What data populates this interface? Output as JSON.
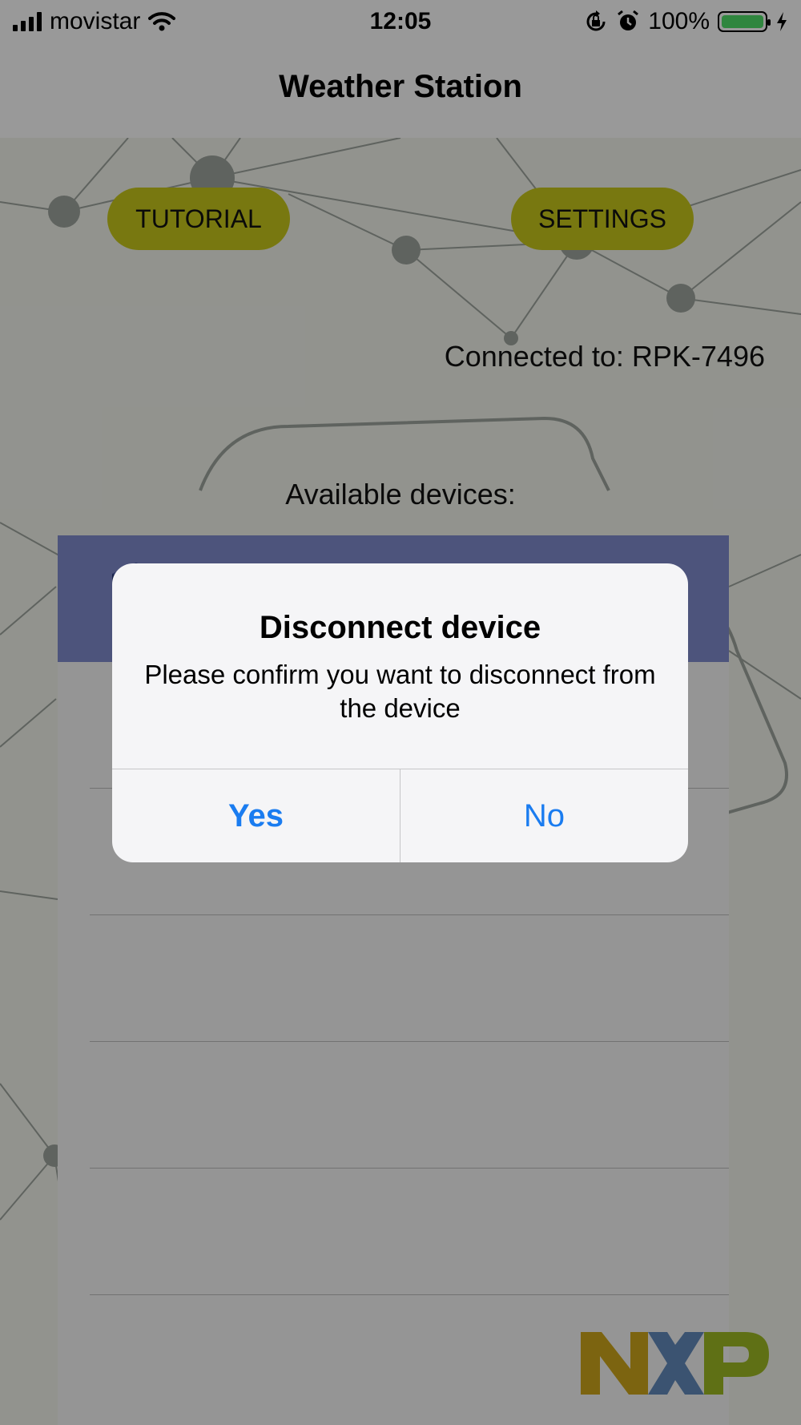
{
  "status_bar": {
    "carrier": "movistar",
    "time": "12:05",
    "battery_percent": "100%",
    "battery_level": 1.0,
    "icons": [
      "signal-icon",
      "wifi-icon",
      "orientation-lock-icon",
      "alarm-icon",
      "battery-icon",
      "charging-icon"
    ]
  },
  "nav": {
    "title": "Weather Station"
  },
  "main": {
    "tutorial_label": "TUTORIAL",
    "settings_label": "SETTINGS",
    "connected_text": "Connected to: RPK-7496",
    "available_label": "Available devices:",
    "logo_text": "NXP",
    "colors": {
      "pill": "#c2c21a",
      "selected_row": "#7c88c8",
      "link_blue": "#1a7cf0"
    }
  },
  "alert": {
    "title": "Disconnect device",
    "message": "Please confirm you want to disconnect from the device",
    "yes_label": "Yes",
    "no_label": "No"
  }
}
